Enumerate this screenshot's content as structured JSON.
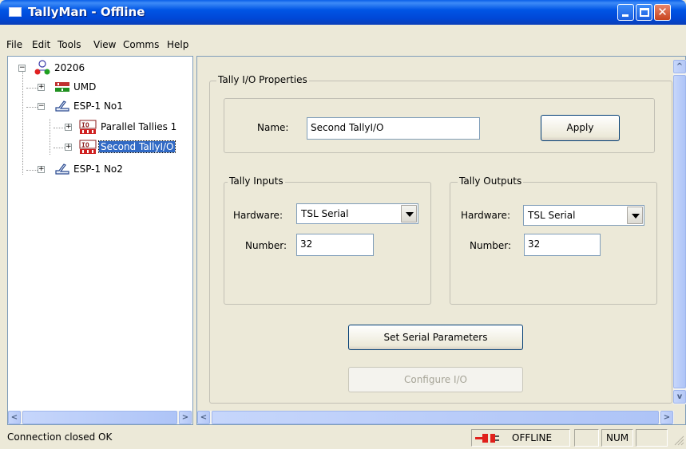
{
  "window": {
    "title": "TallyMan - Offline"
  },
  "menu": [
    "File",
    "Edit",
    "Tools",
    "View",
    "Comms",
    "Help"
  ],
  "tree": {
    "root": "20206",
    "items": [
      {
        "label": "UMD"
      },
      {
        "label": "ESP-1 No1"
      },
      {
        "label": "Parallel Tallies 1"
      },
      {
        "label": "Second TallyI/O"
      },
      {
        "label": "ESP-1 No2"
      }
    ]
  },
  "properties": {
    "group_title": "Tally I/O Properties",
    "name_label": "Name:",
    "name_value": "Second TallyI/O",
    "apply_label": "Apply",
    "inputs": {
      "title": "Tally Inputs",
      "hardware_label": "Hardware:",
      "hardware_value": "TSL Serial",
      "number_label": "Number:",
      "number_value": "32"
    },
    "outputs": {
      "title": "Tally Outputs",
      "hardware_label": "Hardware:",
      "hardware_value": "TSL Serial",
      "number_label": "Number:",
      "number_value": "32"
    },
    "serial_button": "Set Serial Parameters",
    "configure_button": "Configure I/O"
  },
  "status": {
    "message": "Connection closed OK",
    "connection": "OFFLINE",
    "num": "NUM",
    "accent_offline": "#E0201B"
  },
  "icons": {
    "close": "✕"
  }
}
